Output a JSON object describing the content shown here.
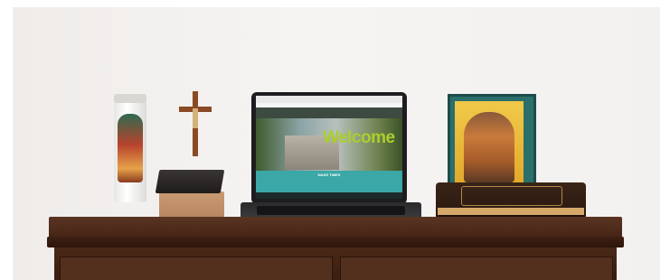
{
  "laptop_screen": {
    "hero_heading": "Welcome",
    "section_title": "MASS TIMES",
    "logo_text": "",
    "body_text": ""
  },
  "colors": {
    "wall": "#f3f1ef",
    "dresser": "#4a2818",
    "site_teal": "#3ba7a6",
    "welcome_green": "#a9cf2c"
  }
}
